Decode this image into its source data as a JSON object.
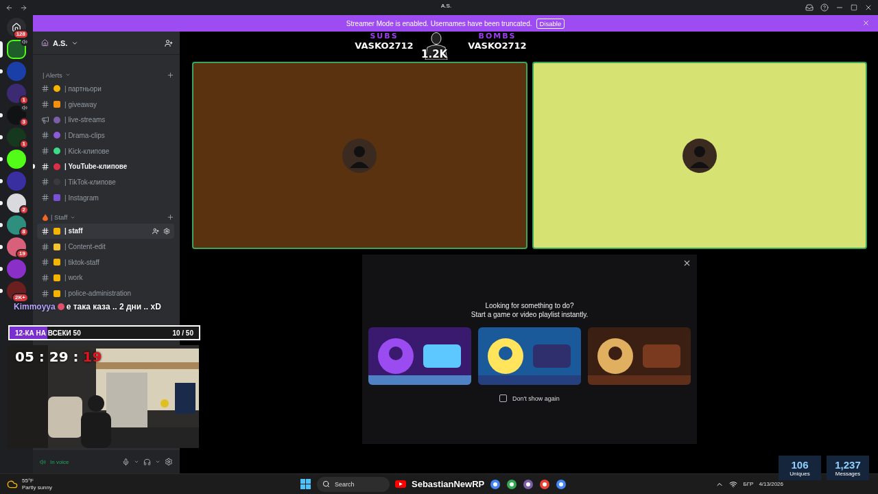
{
  "servers": [
    {
      "kind": "home",
      "color": "#2b2d31",
      "badge": "128",
      "selected": false,
      "voice": false,
      "unread": false
    },
    {
      "kind": "guild",
      "color": "#1f5e2a",
      "selected": true,
      "voice": true,
      "unread": false
    },
    {
      "kind": "guild",
      "color": "#1b3fa8",
      "selected": false,
      "voice": false,
      "unread": true
    },
    {
      "kind": "guild",
      "color": "#3c2a72",
      "badge": "1",
      "selected": false,
      "voice": false,
      "unread": false
    },
    {
      "kind": "guild",
      "color": "#111214",
      "badge": "3",
      "selected": false,
      "voice": true,
      "unread": true
    },
    {
      "kind": "guild",
      "color": "#16381c",
      "badge": "1",
      "selected": false,
      "voice": false,
      "unread": true
    },
    {
      "kind": "guild",
      "color": "#53fc18",
      "selected": false,
      "voice": false,
      "unread": true
    },
    {
      "kind": "guild",
      "color": "#3a2fa0",
      "selected": false,
      "voice": false,
      "unread": true
    },
    {
      "kind": "guild",
      "color": "#d9d9de",
      "badge": "2",
      "selected": false,
      "voice": false,
      "unread": true
    },
    {
      "kind": "guild",
      "color": "#2f8f7f",
      "badge": "8",
      "selected": false,
      "voice": false,
      "unread": true
    },
    {
      "kind": "guild",
      "color": "#d9607a",
      "badge": "19",
      "selected": false,
      "voice": false,
      "unread": true
    },
    {
      "kind": "guild",
      "color": "#8b2fc9",
      "selected": false,
      "voice": false,
      "unread": true
    },
    {
      "kind": "guild",
      "color": "#6b1f1f",
      "badge": "2K+",
      "selected": false,
      "voice": false,
      "unread": true
    }
  ],
  "server": {
    "name": "A.S."
  },
  "categories": [
    {
      "name": "| Alerts",
      "channels": [
        {
          "name": "| партньори",
          "kind": "text",
          "color": "#f4b400",
          "unread": false,
          "hovered": false
        },
        {
          "name": "| giveaway",
          "kind": "private",
          "color": "#f4900c",
          "unread": false,
          "hovered": false
        },
        {
          "name": "| live-streams",
          "kind": "announcement",
          "color": "#7b5ea7",
          "unread": false,
          "hovered": false
        },
        {
          "name": "| Drama-clips",
          "kind": "text",
          "color": "#8e5bd6",
          "unread": false,
          "hovered": false
        },
        {
          "name": "| Kick-клипове",
          "kind": "text",
          "color": "#3ddc84",
          "unread": false,
          "hovered": false
        },
        {
          "name": "| YouTube-клипове",
          "kind": "text",
          "color": "#dd2e44",
          "unread": true,
          "hovered": false
        },
        {
          "name": "| TikTok-клипове",
          "kind": "text",
          "color": "#3a3a40",
          "unread": false,
          "hovered": false
        },
        {
          "name": "| Instagram",
          "kind": "private",
          "color": "#7b4fd6",
          "unread": false,
          "hovered": false
        }
      ]
    },
    {
      "name": "| Staff",
      "color": "#f26522",
      "channels": [
        {
          "name": "| staff",
          "kind": "private",
          "color": "#f4b400",
          "unread": true,
          "hovered": true
        },
        {
          "name": "| Content-edit",
          "kind": "private",
          "color": "#f4c430",
          "unread": false,
          "hovered": false
        },
        {
          "name": "| tiktok-staff",
          "kind": "private",
          "color": "#f4b400",
          "unread": false,
          "hovered": false
        },
        {
          "name": "| work",
          "kind": "private",
          "color": "#f4b400",
          "unread": false,
          "hovered": false
        },
        {
          "name": "| police-administration",
          "kind": "private",
          "color": "#f4b400",
          "unread": false,
          "hovered": false
        }
      ]
    }
  ],
  "user_panel": {
    "status": "In voice"
  },
  "banner": {
    "text": "Streamer Mode is enabled. Usernames have been truncated.",
    "button": "Disable"
  },
  "voice_tiles": [
    {
      "color": "#5a3210",
      "speaking": true
    },
    {
      "color": "#d6e271",
      "speaking": true
    }
  ],
  "activity": {
    "title": "Looking for something to do?",
    "subtitle": "Start a game or video playlist instantly.",
    "checkbox": {
      "label": "Don't show again",
      "checked": false
    }
  },
  "overlay": {
    "subs": {
      "label": "SUBS",
      "name": "VASKO2712"
    },
    "bombs": {
      "label": "BOMBS",
      "name": "VASKO2712"
    },
    "count": "1.2K",
    "tag": "A.S.",
    "chat": {
      "user": "Kimmoyya",
      "message": "е така каза .. 2 дни .. xD"
    },
    "goal": {
      "title": "12-КА НА ВСЕКИ 50",
      "progress": "10 / 50",
      "level": 0.2
    },
    "timer": {
      "main": "05 : 29 :",
      "seconds": "19"
    },
    "stats": [
      {
        "value": "106",
        "label": "Uniques"
      },
      {
        "value": "1,237",
        "label": "Messages"
      }
    ],
    "alert": "SebastianNewRP"
  },
  "taskbar": {
    "weather": {
      "temp": "55°F",
      "condition": "Partly sunny"
    },
    "search": {
      "placeholder": "Search"
    },
    "language": "БГР",
    "date": "4/13/2026"
  }
}
